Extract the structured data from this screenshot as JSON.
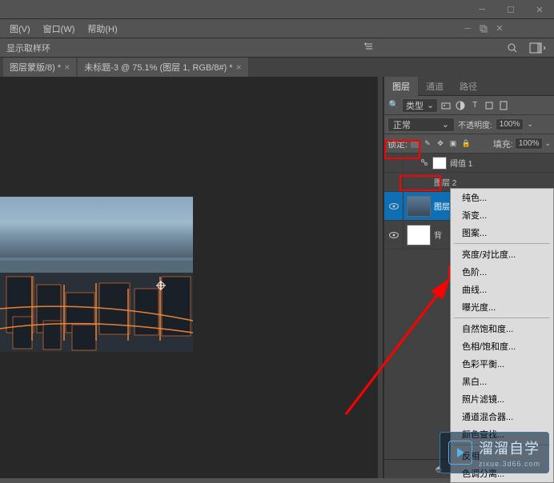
{
  "menubar": {
    "view": "图(V)",
    "window": "窗口(W)",
    "help": "帮助(H)"
  },
  "optionbar": {
    "label": "显示取样环"
  },
  "tabs": [
    {
      "title": "图层蒙版/8) *",
      "closable": true
    },
    {
      "title": "未标题-3 @ 75.1% (图层 1, RGB/8#) *",
      "closable": true
    }
  ],
  "panel_tabs": {
    "layers": "图层",
    "channels": "通道",
    "paths": "路径"
  },
  "layer_filter": {
    "kind_label": "类型"
  },
  "layer_mode": {
    "mode": "正常",
    "opacity_label": "不透明度:",
    "opacity_value": "100%"
  },
  "layer_lock": {
    "label": "锁定:",
    "fill_label": "填充:",
    "fill_value": "100%"
  },
  "layers": [
    {
      "name": "阈值 1"
    },
    {
      "name": "图层 2"
    },
    {
      "name": "图层 1"
    },
    {
      "name": "背"
    }
  ],
  "context_menu": {
    "solid": "纯色...",
    "gradient": "渐变...",
    "pattern": "图案...",
    "brightness": "亮度/对比度...",
    "levels": "色阶...",
    "curves": "曲线...",
    "exposure": "曝光度...",
    "natural_saturation": "自然饱和度...",
    "hue": "色相/饱和度...",
    "color_balance": "色彩平衡...",
    "bw": "黑白...",
    "photo_filter": "照片滤镜...",
    "channel_mixer": "通道混合器...",
    "color_lookup": "颜色查找...",
    "invert": "反相",
    "posterize": "色调分离..."
  },
  "watermark": {
    "brand": "溜溜自学",
    "url": "zixue.3d66.com"
  }
}
